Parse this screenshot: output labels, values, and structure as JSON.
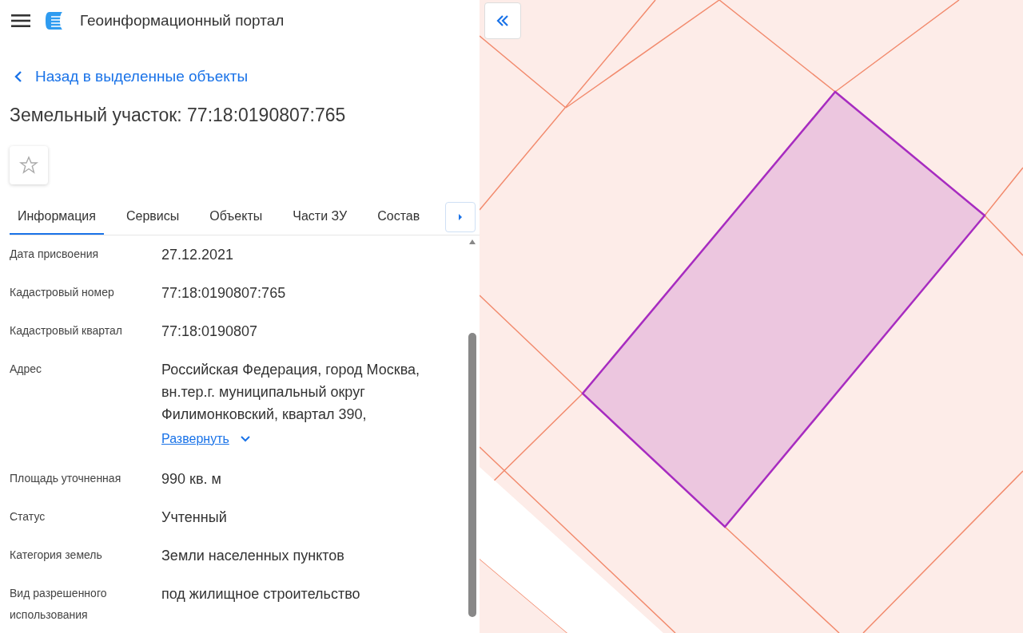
{
  "header": {
    "title": "Геоинформационный портал"
  },
  "back_link": "Назад в выделенные объекты",
  "object_title": "Земельный участок: 77:18:0190807:765",
  "favorite": {
    "on": false
  },
  "tabs": [
    {
      "label": "Информация",
      "selected": true
    },
    {
      "label": "Сервисы",
      "selected": false
    },
    {
      "label": "Объекты",
      "selected": false
    },
    {
      "label": "Части ЗУ",
      "selected": false
    },
    {
      "label": "Состав",
      "selected": false
    }
  ],
  "fields": [
    {
      "label": "Дата присвоения",
      "value": "27.12.2021"
    },
    {
      "label": "Кадастровый номер",
      "value": "77:18:0190807:765"
    },
    {
      "label": "Кадастровый квартал",
      "value": "77:18:0190807"
    },
    {
      "label": "Адрес",
      "value": "Российская Федерация, город Москва, вн.тер.г. муниципальный округ Филимонковский, квартал 390,",
      "expand_link": "Развернуть"
    },
    {
      "label": "Площадь уточненная",
      "value": "990 кв. м"
    },
    {
      "label": "Статус",
      "value": "Учтенный"
    },
    {
      "label": "Категория земель",
      "value": "Земли населенных пунктов"
    },
    {
      "label": "Вид разрешенного использования",
      "value": "под жилищное строительство"
    }
  ]
}
